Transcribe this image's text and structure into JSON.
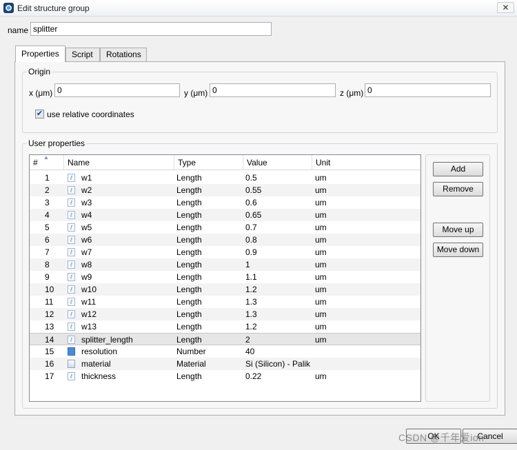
{
  "window": {
    "title": "Edit structure group",
    "close_label": "✕"
  },
  "name_field": {
    "label": "name",
    "value": "splitter"
  },
  "tabs": [
    {
      "label": "Properties",
      "active": true
    },
    {
      "label": "Script",
      "active": false
    },
    {
      "label": "Rotations",
      "active": false
    }
  ],
  "origin": {
    "title": "Origin",
    "x": {
      "label": "x (μm)",
      "value": "0"
    },
    "y": {
      "label": "y (μm)",
      "value": "0"
    },
    "z": {
      "label": "z (μm)",
      "value": "0"
    },
    "relative": {
      "label": "use relative coordinates",
      "checked": true
    }
  },
  "user_properties": {
    "title": "User properties",
    "columns": [
      "#",
      "Name",
      "Type",
      "Value",
      "Unit"
    ],
    "rows": [
      {
        "num": "1",
        "icon": "length-icon",
        "name": "w1",
        "type": "Length",
        "value": "0.5",
        "unit": "um"
      },
      {
        "num": "2",
        "icon": "length-icon",
        "name": "w2",
        "type": "Length",
        "value": "0.55",
        "unit": "um"
      },
      {
        "num": "3",
        "icon": "length-icon",
        "name": "w3",
        "type": "Length",
        "value": "0.6",
        "unit": "um"
      },
      {
        "num": "4",
        "icon": "length-icon",
        "name": "w4",
        "type": "Length",
        "value": "0.65",
        "unit": "um"
      },
      {
        "num": "5",
        "icon": "length-icon",
        "name": "w5",
        "type": "Length",
        "value": "0.7",
        "unit": "um"
      },
      {
        "num": "6",
        "icon": "length-icon",
        "name": "w6",
        "type": "Length",
        "value": "0.8",
        "unit": "um"
      },
      {
        "num": "7",
        "icon": "length-icon",
        "name": "w7",
        "type": "Length",
        "value": "0.9",
        "unit": "um"
      },
      {
        "num": "8",
        "icon": "length-icon",
        "name": "w8",
        "type": "Length",
        "value": "1",
        "unit": "um"
      },
      {
        "num": "9",
        "icon": "length-icon",
        "name": "w9",
        "type": "Length",
        "value": "1.1",
        "unit": "um"
      },
      {
        "num": "10",
        "icon": "length-icon",
        "name": "w10",
        "type": "Length",
        "value": "1.2",
        "unit": "um"
      },
      {
        "num": "11",
        "icon": "length-icon",
        "name": "w11",
        "type": "Length",
        "value": "1.3",
        "unit": "um"
      },
      {
        "num": "12",
        "icon": "length-icon",
        "name": "w12",
        "type": "Length",
        "value": "1.3",
        "unit": "um"
      },
      {
        "num": "13",
        "icon": "length-icon",
        "name": "w13",
        "type": "Length",
        "value": "1.2",
        "unit": "um"
      },
      {
        "num": "14",
        "icon": "length-icon",
        "name": "splitter_length",
        "type": "Length",
        "value": "2",
        "unit": "um",
        "selected": true
      },
      {
        "num": "15",
        "icon": "number-icon",
        "name": "resolution",
        "type": "Number",
        "value": "40",
        "unit": ""
      },
      {
        "num": "16",
        "icon": "material-icon",
        "name": "material",
        "type": "Material",
        "value": "Si (Silicon) - Palik",
        "unit": ""
      },
      {
        "num": "17",
        "icon": "length-icon",
        "name": "thickness",
        "type": "Length",
        "value": "0.22",
        "unit": "um"
      }
    ]
  },
  "actions": {
    "add": "Add",
    "remove": "Remove",
    "move_up": "Move up",
    "move_down": "Move down"
  },
  "dialog_buttons": {
    "ok": "OK",
    "cancel": "Cancel"
  },
  "watermark": "CSDN @千年爱ion"
}
